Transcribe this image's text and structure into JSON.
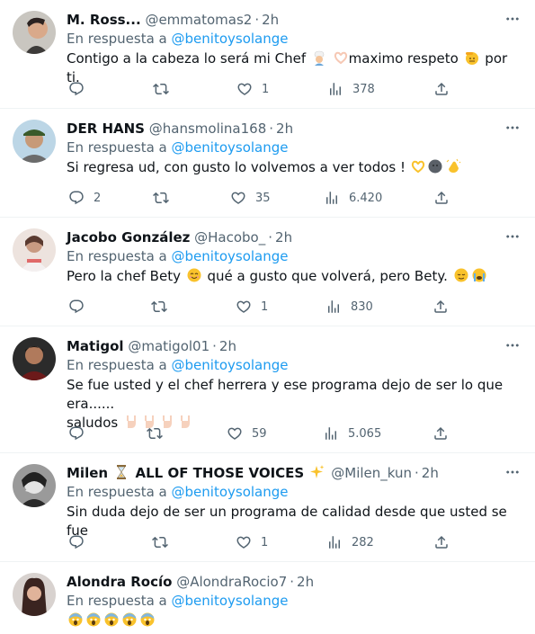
{
  "reply_prefix": "En respuesta a",
  "reply_mention": "@benitoysolange",
  "tweets": [
    {
      "name": "M. Ross...",
      "handle": "@emmatomas2",
      "time": "2h",
      "text_a": "Contigo a la cabeza lo será mi Chef ",
      "text_b": "maximo respeto ",
      "text_c": " por ti.",
      "replies": "",
      "retweets": "",
      "likes": "1",
      "views": "378"
    },
    {
      "name": "DER HANS",
      "handle": "@hansmolina168",
      "time": "2h",
      "text_a": "Si regresa ud, con gusto lo volvemos a ver todos ! ",
      "replies": "2",
      "retweets": "",
      "likes": "35",
      "views": "6.420"
    },
    {
      "name": "Jacobo González",
      "handle": "@Hacobo_",
      "time": "2h",
      "text_a": "Pero la chef Bety ",
      "text_b": " qué a gusto que volverá, pero Bety. ",
      "replies": "",
      "retweets": "",
      "likes": "1",
      "views": "830"
    },
    {
      "name": "Matigol",
      "handle": "@matigol01",
      "time": "2h",
      "text_a": "Se fue usted y el chef herrera y ese programa dejo de ser lo que era......",
      "text_b": "saludos ",
      "replies": "",
      "retweets": "",
      "likes": "59",
      "views": "5.065"
    },
    {
      "name_a": "Milen ",
      "name_b": " ALL OF THOSE VOICES ",
      "handle": "@Milen_kun",
      "time": "2h",
      "text_a": "Sin duda dejo de ser un programa de calidad desde que usted se fue",
      "replies": "",
      "retweets": "",
      "likes": "1",
      "views": "282"
    },
    {
      "name": "Alondra Rocío",
      "handle": "@AlondraRocio7",
      "time": "2h",
      "text_a": ""
    }
  ],
  "icons": {
    "reply": "reply-icon",
    "retweet": "retweet-icon",
    "like": "heart-icon",
    "views": "views-icon",
    "share": "share-icon",
    "more": "more-icon"
  },
  "colors": {
    "text": "#0f1419",
    "secondary": "#536471",
    "link": "#1d9bf0",
    "border": "#eff3f4"
  }
}
